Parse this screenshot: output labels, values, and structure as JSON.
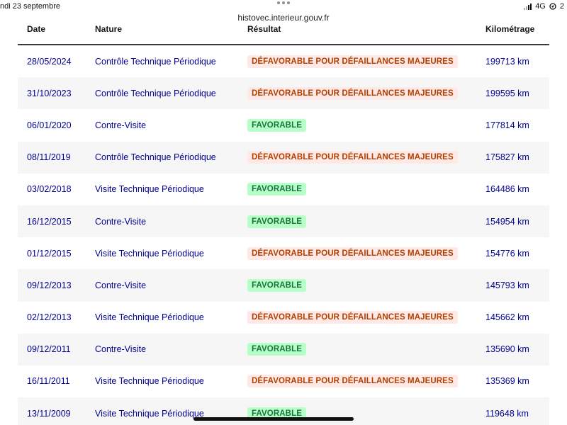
{
  "status_bar": {
    "date": "ndi 23 septembre",
    "network": "4G",
    "battery_partial": "2",
    "signal_icon": "signal-bars-icon",
    "location_icon": "location-icon"
  },
  "browser": {
    "url": "histovec.interieur.gouv.fr"
  },
  "colors": {
    "link_blue": "#000091",
    "favorable_bg": "#b8fec9",
    "favorable_text": "#18753c",
    "defavorable_bg": "#ffe9e6",
    "defavorable_text": "#b34000"
  },
  "table": {
    "headers": {
      "date": "Date",
      "nature": "Nature",
      "result": "Résultat",
      "km": "Kilométrage"
    },
    "rows": [
      {
        "date": "28/05/2024",
        "nature": "Contrôle Technique Périodique",
        "result": "DÉFAVORABLE POUR DÉFAILLANCES MAJEURES",
        "status": "defavorable",
        "km": "199713 km"
      },
      {
        "date": "31/10/2023",
        "nature": "Contrôle Technique Périodique",
        "result": "DÉFAVORABLE POUR DÉFAILLANCES MAJEURES",
        "status": "defavorable",
        "km": "199595 km"
      },
      {
        "date": "06/01/2020",
        "nature": "Contre-Visite",
        "result": "FAVORABLE",
        "status": "favorable",
        "km": "177814 km"
      },
      {
        "date": "08/11/2019",
        "nature": "Contrôle Technique Périodique",
        "result": "DÉFAVORABLE POUR DÉFAILLANCES MAJEURES",
        "status": "defavorable",
        "km": "175827 km"
      },
      {
        "date": "03/02/2018",
        "nature": "Visite Technique Périodique",
        "result": "FAVORABLE",
        "status": "favorable",
        "km": "164486 km"
      },
      {
        "date": "16/12/2015",
        "nature": "Contre-Visite",
        "result": "FAVORABLE",
        "status": "favorable",
        "km": "154954 km"
      },
      {
        "date": "01/12/2015",
        "nature": "Visite Technique Périodique",
        "result": "DÉFAVORABLE POUR DÉFAILLANCES MAJEURES",
        "status": "defavorable",
        "km": "154776 km"
      },
      {
        "date": "09/12/2013",
        "nature": "Contre-Visite",
        "result": "FAVORABLE",
        "status": "favorable",
        "km": "145793 km"
      },
      {
        "date": "02/12/2013",
        "nature": "Visite Technique Périodique",
        "result": "DÉFAVORABLE POUR DÉFAILLANCES MAJEURES",
        "status": "defavorable",
        "km": "145662 km"
      },
      {
        "date": "09/12/2011",
        "nature": "Contre-Visite",
        "result": "FAVORABLE",
        "status": "favorable",
        "km": "135690 km"
      },
      {
        "date": "16/11/2011",
        "nature": "Visite Technique Périodique",
        "result": "DÉFAVORABLE POUR DÉFAILLANCES MAJEURES",
        "status": "defavorable",
        "km": "135369 km"
      },
      {
        "date": "13/11/2009",
        "nature": "Visite Technique Périodique",
        "result": "FAVORABLE",
        "status": "favorable",
        "km": "119648 km"
      }
    ]
  }
}
